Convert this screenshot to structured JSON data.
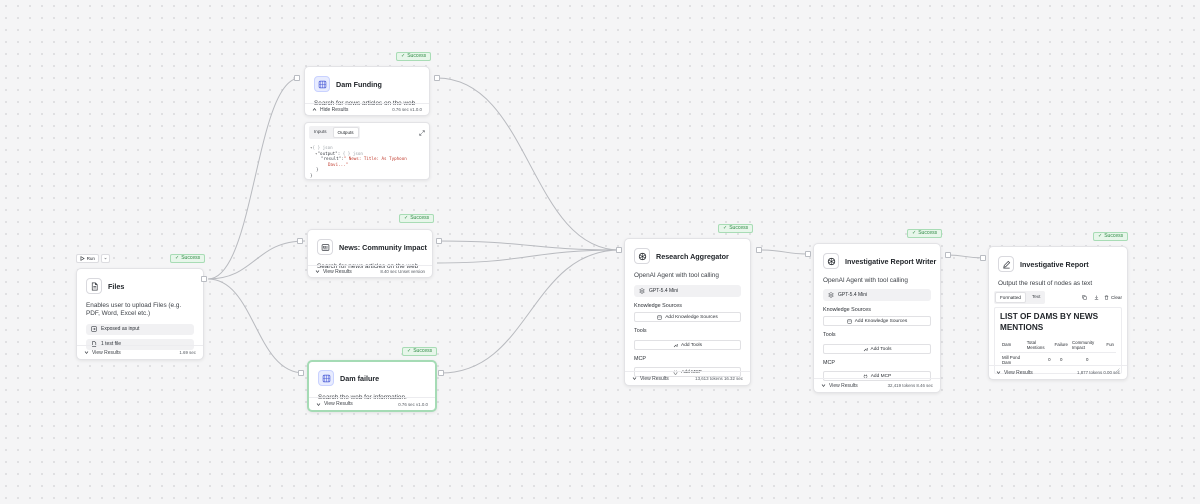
{
  "toolbar": {
    "run_label": "Run"
  },
  "colors": {
    "success_bg": "#e7f6ea",
    "success_text": "#2f8a45",
    "accent_blue": "#e8ecff"
  },
  "nodes": {
    "files": {
      "status": "Success",
      "title": "Files",
      "description": "Enables user to upload Files (e.g. PDF, Word, Excel etc.)",
      "exposed_label": "Exposed as input",
      "file_count": "1 test file",
      "view_results": "View Results",
      "meta": "1.69 sec",
      "icon": "file-icon"
    },
    "dam_funding": {
      "status": "Success",
      "title": "Dam Funding",
      "description": "Search for news articles on the web",
      "hide_results": "Hide Results",
      "meta": "0.76 sec  v1.0.0",
      "icon": "globe-icon",
      "output_panel": {
        "tabs": [
          "Inputs",
          "Outputs"
        ],
        "line1": "{ } json",
        "line2_key": "\"output\":",
        "line2_rest": "{ } json",
        "line3_key": "\"result\":",
        "line3_val": "\" News: Title: As Typhoon",
        "line4_val": "Davi...\"",
        "line5": "}",
        "line6": "}"
      }
    },
    "news_community": {
      "status": "Success",
      "title": "News: Community Impact",
      "description": "Search for news articles on the web",
      "view_results": "View Results",
      "meta": "8.40 sec  Unset version",
      "icon": "newspaper-icon"
    },
    "dam_failure": {
      "status": "Success",
      "title": "Dam failure",
      "description": "Search the web for information.",
      "view_results": "View Results",
      "meta": "0.76 sec  v1.0.0",
      "icon": "globe-icon"
    },
    "research_aggregator": {
      "status": "Success",
      "title": "Research Aggregator",
      "description": "OpenAI Agent with tool calling",
      "model": "GPT-5.4 Mini",
      "knowledge_label": "Knowledge Sources",
      "add_knowledge": "Add Knowledge Sources",
      "tools_label": "Tools",
      "add_tools": "Add Tools",
      "mcp_label": "MCP",
      "add_mcp": "Add MCP",
      "view_results": "View Results",
      "meta": "13,613 tokens  16.32 sec",
      "icon": "openai-icon"
    },
    "report_writer": {
      "status": "Success",
      "title": "Investigative Report Writer",
      "description": "OpenAI Agent with tool calling",
      "model": "GPT-5.4 Mini",
      "knowledge_label": "Knowledge Sources",
      "add_knowledge": "Add Knowledge Sources",
      "tools_label": "Tools",
      "add_tools": "Add Tools",
      "mcp_label": "MCP",
      "add_mcp": "Add MCP",
      "view_results": "View Results",
      "meta": "32,419 tokens  8.46 sec",
      "icon": "openai-icon"
    },
    "report": {
      "status": "Success",
      "title": "Investigative Report",
      "description": "Output the result of nodes as text",
      "tabs": [
        "Formatted",
        "Text"
      ],
      "clear_label": "Clear",
      "heading": "LIST OF DAMS BY NEWS MENTIONS",
      "table_headers": [
        "Dam",
        "Total Mentions",
        "Failure",
        "Community Impact",
        "Fun"
      ],
      "table_rows": [
        [
          "Mill Pond Dam",
          "0",
          "0",
          "0",
          ""
        ]
      ],
      "view_results": "View Results",
      "meta": "1,877 tokens  0.00 sec",
      "icon": "pen-icon"
    }
  }
}
